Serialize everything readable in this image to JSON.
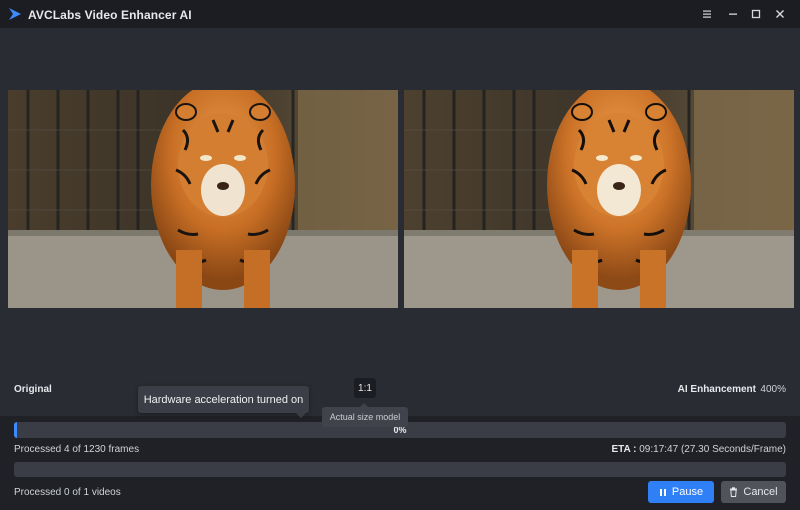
{
  "window": {
    "title": "AVCLabs Video Enhancer AI",
    "controls": [
      "menu-icon",
      "minimize-icon",
      "maximize-icon",
      "close-icon"
    ]
  },
  "preview": {
    "left_label": "Original",
    "right_label": "AI Enhancement",
    "scale": "400%",
    "ratio_button": "1:1"
  },
  "tooltips": {
    "hardware": "Hardware acceleration turned on",
    "actual_size": "Actual size model"
  },
  "progress": {
    "frames_percent_text": "0%",
    "frames_fraction": 0.003,
    "frames_status": "Processed 4 of 1230 frames",
    "eta_label": "ETA :",
    "eta_value": "09:17:47 (27.30 Seconds/Frame)",
    "videos_fraction": 0,
    "videos_status": "Processed 0 of 1 videos"
  },
  "buttons": {
    "pause": "Pause",
    "pause_icon": "pause-icon",
    "cancel": "Cancel",
    "cancel_icon": "trash-icon"
  },
  "colors": {
    "accent": "#2f7ff6",
    "background": "#1f2127",
    "preview_bg": "#2a2c33"
  }
}
